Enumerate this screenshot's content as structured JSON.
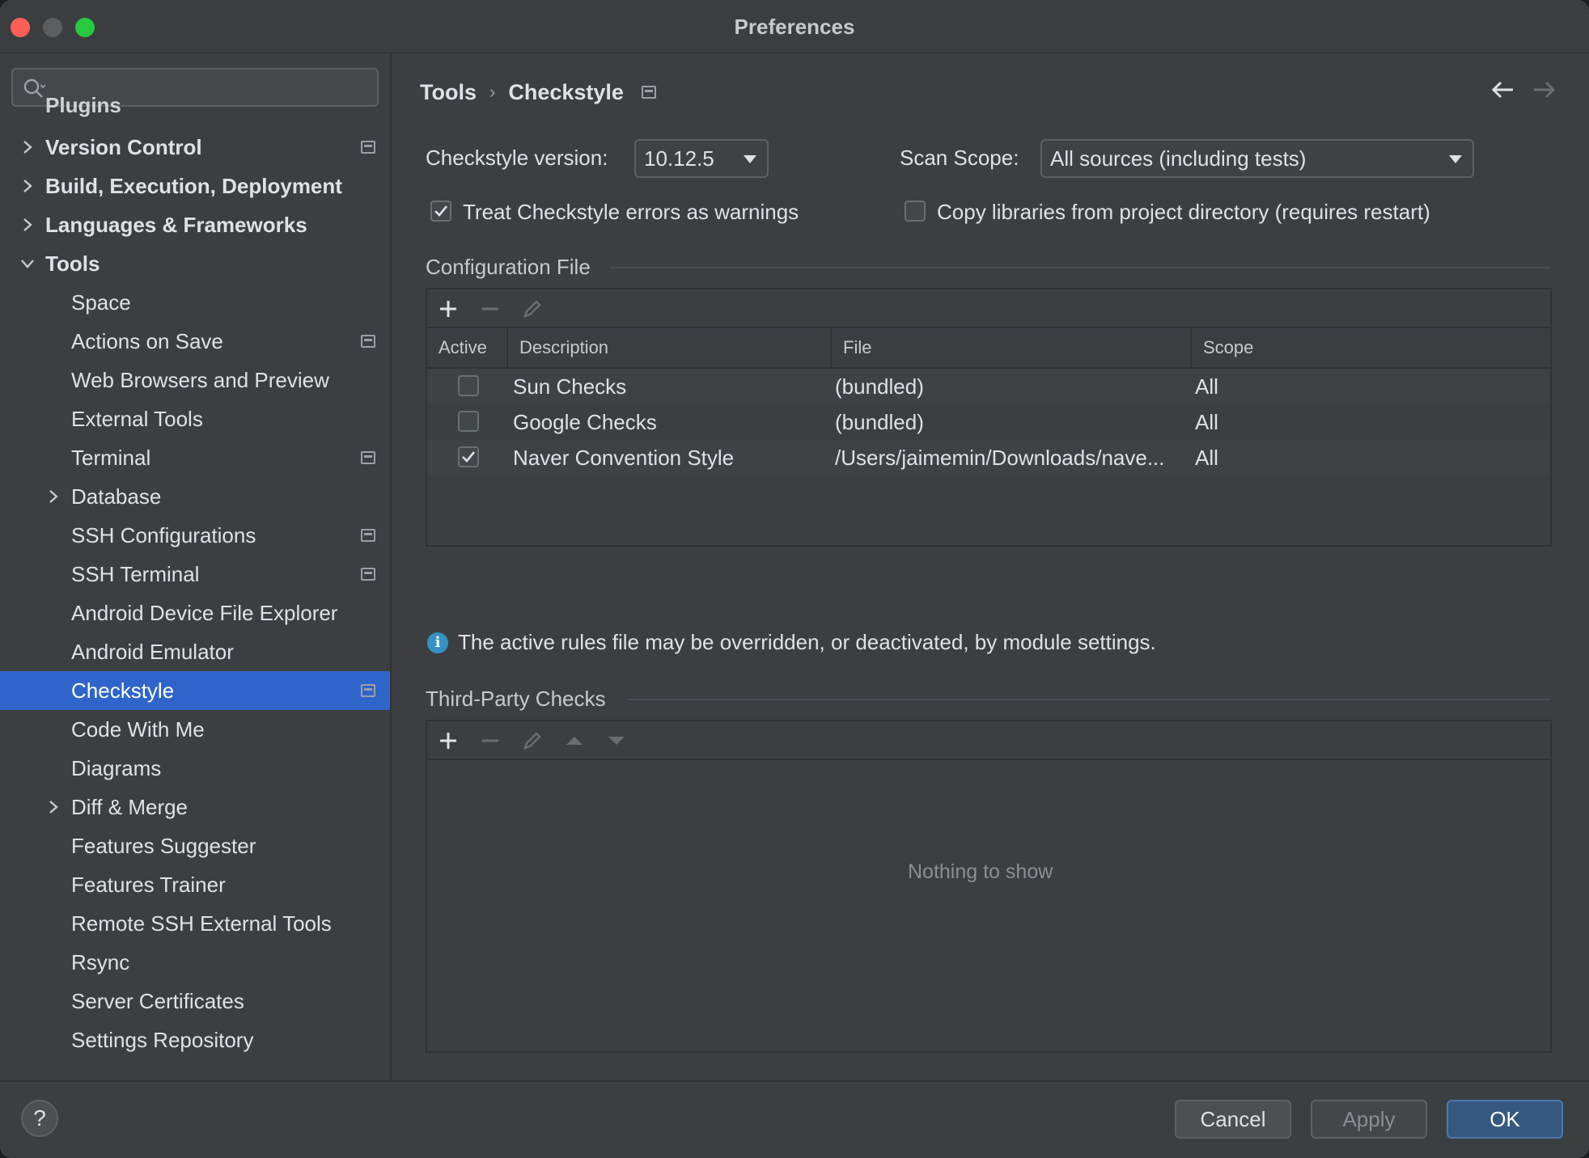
{
  "window": {
    "title": "Preferences"
  },
  "search": {
    "placeholder": ""
  },
  "sidebar": {
    "partial_item": "Plugins",
    "items": [
      {
        "label": "Version Control",
        "level": 0,
        "expanded": false,
        "project": true
      },
      {
        "label": "Build, Execution, Deployment",
        "level": 0,
        "expanded": false,
        "project": false
      },
      {
        "label": "Languages & Frameworks",
        "level": 0,
        "expanded": false,
        "project": false
      },
      {
        "label": "Tools",
        "level": 0,
        "expanded": true,
        "project": false
      },
      {
        "label": "Space",
        "level": 1,
        "project": false
      },
      {
        "label": "Actions on Save",
        "level": 1,
        "project": true
      },
      {
        "label": "Web Browsers and Preview",
        "level": 1,
        "project": false
      },
      {
        "label": "External Tools",
        "level": 1,
        "project": false
      },
      {
        "label": "Terminal",
        "level": 1,
        "project": true
      },
      {
        "label": "Database",
        "level": 1,
        "expandable": true,
        "project": false
      },
      {
        "label": "SSH Configurations",
        "level": 1,
        "project": true
      },
      {
        "label": "SSH Terminal",
        "level": 1,
        "project": true
      },
      {
        "label": "Android Device File Explorer",
        "level": 1,
        "project": false
      },
      {
        "label": "Android Emulator",
        "level": 1,
        "project": false
      },
      {
        "label": "Checkstyle",
        "level": 1,
        "project": true,
        "selected": true
      },
      {
        "label": "Code With Me",
        "level": 1,
        "project": false
      },
      {
        "label": "Diagrams",
        "level": 1,
        "project": false
      },
      {
        "label": "Diff & Merge",
        "level": 1,
        "expandable": true,
        "project": false
      },
      {
        "label": "Features Suggester",
        "level": 1,
        "project": false
      },
      {
        "label": "Features Trainer",
        "level": 1,
        "project": false
      },
      {
        "label": "Remote SSH External Tools",
        "level": 1,
        "project": false
      },
      {
        "label": "Rsync",
        "level": 1,
        "project": false
      },
      {
        "label": "Server Certificates",
        "level": 1,
        "project": false
      },
      {
        "label": "Settings Repository",
        "level": 1,
        "project": false
      }
    ]
  },
  "breadcrumb": {
    "parent": "Tools",
    "current": "Checkstyle"
  },
  "settings": {
    "version_label": "Checkstyle version:",
    "version_value": "10.12.5",
    "scope_label": "Scan Scope:",
    "scope_value": "All sources (including tests)",
    "treat_errors_label": "Treat Checkstyle errors as warnings",
    "treat_errors_checked": true,
    "copy_libs_label": "Copy libraries from project directory (requires restart)",
    "copy_libs_checked": false
  },
  "config_file": {
    "title": "Configuration File",
    "columns": [
      "Active",
      "Description",
      "File",
      "Scope"
    ],
    "rows": [
      {
        "active": false,
        "description": "Sun Checks",
        "file": "(bundled)",
        "scope": "All"
      },
      {
        "active": false,
        "description": "Google Checks",
        "file": "(bundled)",
        "scope": "All"
      },
      {
        "active": true,
        "description": "Naver Convention Style",
        "file": "/Users/jaimemin/Downloads/nave...",
        "scope": "All"
      }
    ]
  },
  "info_message": "The active rules file may be overridden, or deactivated, by module settings.",
  "third_party": {
    "title": "Third-Party Checks",
    "empty_text": "Nothing to show"
  },
  "footer": {
    "help_label": "?",
    "cancel_label": "Cancel",
    "apply_label": "Apply",
    "ok_label": "OK"
  },
  "colors": {
    "selection": "#2f65ca",
    "ok_button": "#365880",
    "info": "#3592c4"
  }
}
